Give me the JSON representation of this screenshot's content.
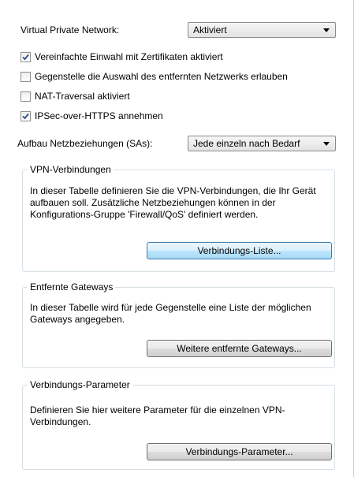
{
  "vpn": {
    "label": "Virtual Private Network:",
    "value": "Aktiviert"
  },
  "checkboxes": [
    {
      "label": "Vereinfachte Einwahl mit Zertifikaten aktiviert",
      "checked": true
    },
    {
      "label": "Gegenstelle die Auswahl des entfernten Netzwerks erlauben",
      "checked": false
    },
    {
      "label": "NAT-Traversal aktiviert",
      "checked": false
    },
    {
      "label": "IPSec-over-HTTPS annehmen",
      "checked": true
    }
  ],
  "sa": {
    "label": "Aufbau Netzbeziehungen (SAs):",
    "value": "Jede einzeln nach Bedarf"
  },
  "groups": [
    {
      "title": "VPN-Verbindungen",
      "text": "In dieser Tabelle definieren Sie die VPN-Verbindungen, die Ihr Gerät aufbauen soll. Zusätzliche Netzbeziehungen können in der Konfigurations-Gruppe 'Firewall/QoS' definiert werden.",
      "button": "Verbindungs-Liste..."
    },
    {
      "title": "Entfernte Gateways",
      "text": "In dieser Tabelle wird für jede Gegenstelle eine Liste der möglichen Gateways angegeben.",
      "button": "Weitere entfernte Gateways..."
    },
    {
      "title": "Verbindungs-Parameter",
      "text": "Definieren Sie hier weitere Parameter für die einzelnen VPN-Verbindungen.",
      "button": "Verbindungs-Parameter..."
    }
  ]
}
